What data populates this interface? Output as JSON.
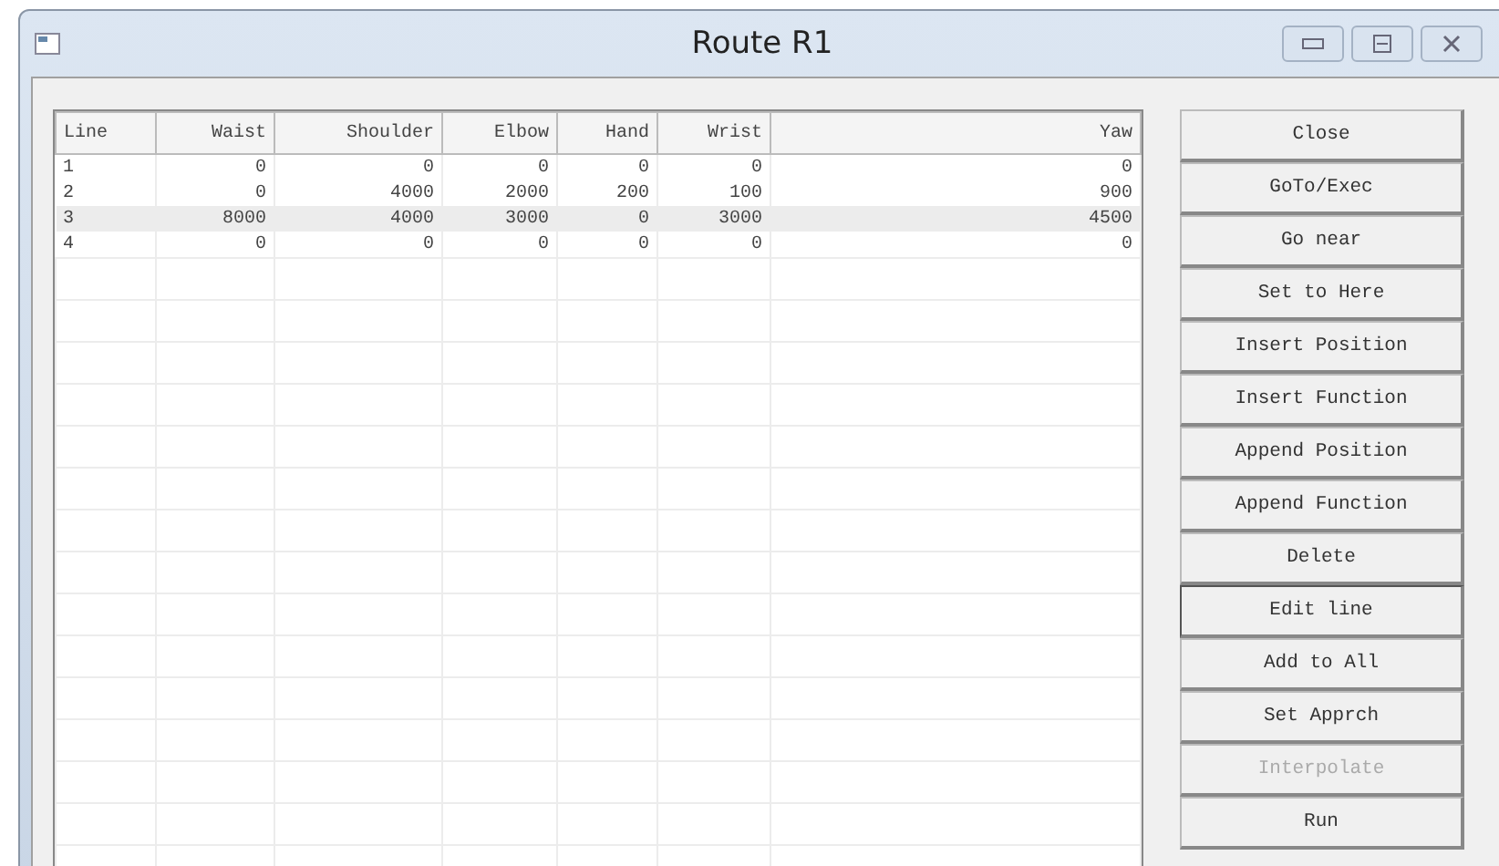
{
  "window": {
    "title": "Route R1"
  },
  "table": {
    "columns": [
      "Line",
      "Waist",
      "Shoulder",
      "Elbow",
      "Hand",
      "Wrist",
      "Yaw"
    ],
    "rows": [
      {
        "cells": [
          "1",
          "0",
          "0",
          "0",
          "0",
          "0",
          "0"
        ],
        "selected": false
      },
      {
        "cells": [
          "2",
          "0",
          "4000",
          "2000",
          "200",
          "100",
          "900"
        ],
        "selected": false
      },
      {
        "cells": [
          "3",
          "8000",
          "4000",
          "3000",
          "0",
          "3000",
          "4500"
        ],
        "selected": true
      },
      {
        "cells": [
          "4",
          "0",
          "0",
          "0",
          "0",
          "0",
          "0"
        ],
        "selected": false
      }
    ]
  },
  "buttons": [
    {
      "label": "Close",
      "focused": false,
      "disabled": false
    },
    {
      "label": "GoTo/Exec",
      "focused": false,
      "disabled": false
    },
    {
      "label": "Go near",
      "focused": false,
      "disabled": false
    },
    {
      "label": "Set to Here",
      "focused": false,
      "disabled": false
    },
    {
      "label": "Insert Position",
      "focused": false,
      "disabled": false
    },
    {
      "label": "Insert Function",
      "focused": false,
      "disabled": false
    },
    {
      "label": "Append Position",
      "focused": false,
      "disabled": false
    },
    {
      "label": "Append Function",
      "focused": false,
      "disabled": false
    },
    {
      "label": "Delete",
      "focused": false,
      "disabled": false
    },
    {
      "label": "Edit line",
      "focused": true,
      "disabled": false
    },
    {
      "label": "Add to All",
      "focused": false,
      "disabled": false
    },
    {
      "label": "Set Apprch",
      "focused": false,
      "disabled": false
    },
    {
      "label": "Interpolate",
      "focused": false,
      "disabled": true
    },
    {
      "label": "Run",
      "focused": false,
      "disabled": false
    }
  ]
}
